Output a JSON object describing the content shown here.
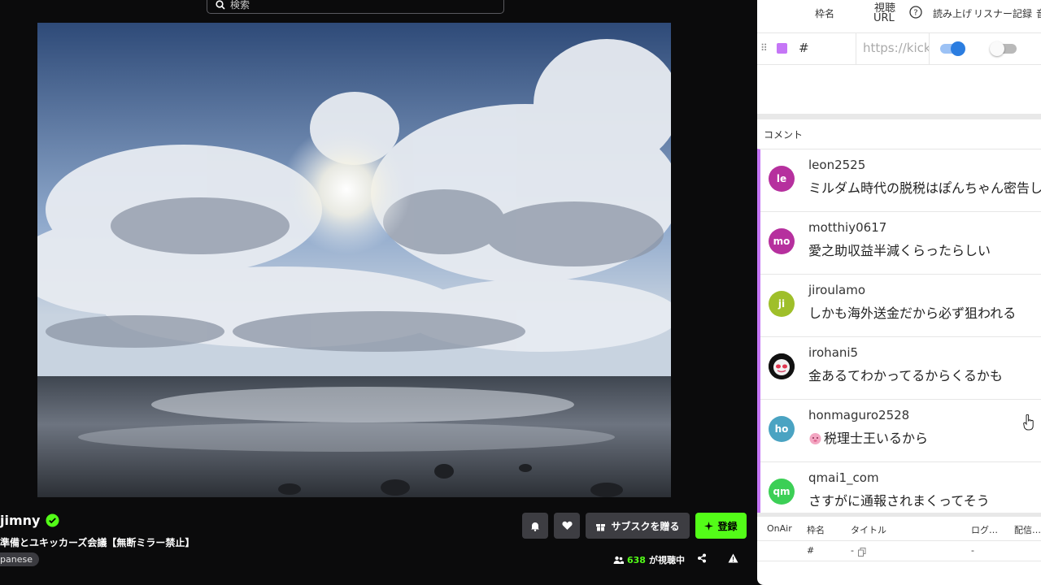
{
  "search": {
    "placeholder": "検索"
  },
  "stream": {
    "streamer": "jimny",
    "title": "準備とユキッカーズ会議【無断ミラー禁止】",
    "tag": "panese",
    "viewers_count": "638",
    "viewers_suffix": "が視聴中",
    "buttons": {
      "gift_sub": "サブスクを贈る",
      "subscribe": "登録"
    }
  },
  "panel": {
    "header": {
      "col_name": "枠名",
      "col_url_line1": "視聴",
      "col_url_line2": "URL",
      "col_read": "読み上げ",
      "col_listener": "リスナー記録",
      "col_cut": "音"
    },
    "row": {
      "name": "#",
      "url": "https://kick.com/",
      "read_on": true,
      "listener_on": false
    },
    "comments_label": "コメント",
    "comments": [
      {
        "initials": "le",
        "user": "leon2525",
        "text": "ミルダム時代の脱税はぽんちゃん密告し",
        "color": "#b6309e"
      },
      {
        "initials": "mo",
        "user": "motthiy0617",
        "text": "愛之助収益半減くらったらしい",
        "color": "#b6309e"
      },
      {
        "initials": "ji",
        "user": "jiroulamo",
        "text": "しかも海外送金だから必ず狙われる",
        "color": "#9fbf2a"
      },
      {
        "initials": "",
        "user": "irohani5",
        "text": "金あるてわかってるからくるかも",
        "color": "#111111"
      },
      {
        "initials": "ho",
        "user": "honmaguro2528",
        "text": "税理士王いるから",
        "color": "#4aa3c2"
      },
      {
        "initials": "qm",
        "user": "qmai1_com",
        "text": "さすがに通報されまくってそう",
        "color": "#3ccf56"
      }
    ],
    "table": {
      "headers": [
        "OnAir",
        "枠名",
        "タイトル",
        "ログ…",
        "配信…"
      ],
      "row": {
        "name": "#",
        "title": "-",
        "log": "-"
      }
    }
  }
}
